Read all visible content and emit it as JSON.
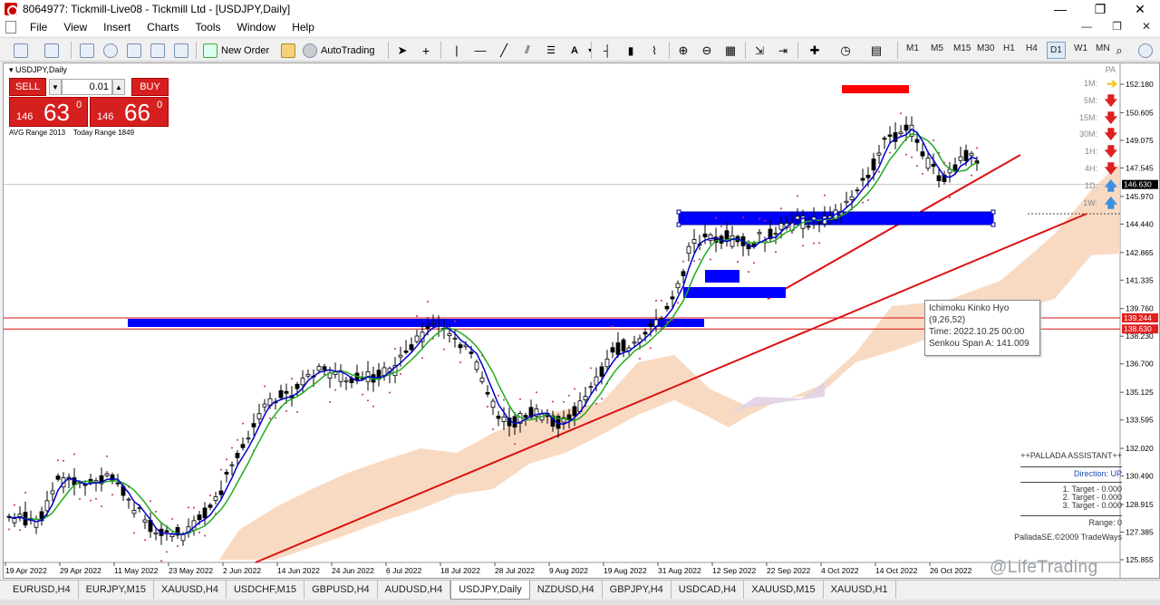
{
  "window": {
    "title": "8064977: Tickmill-Live08 - Tickmill Ltd - [USDJPY,Daily]",
    "minimize": "—",
    "maximize": "❐",
    "close": "✕"
  },
  "menu": {
    "items": [
      "File",
      "View",
      "Insert",
      "Charts",
      "Tools",
      "Window",
      "Help"
    ],
    "right_controls": [
      "—",
      "❐",
      "✕"
    ]
  },
  "toolbar": {
    "new_order_label": "New Order",
    "autotrading_label": "AutoTrading",
    "timeframes": [
      "M1",
      "M5",
      "M15",
      "M30",
      "H1",
      "H4",
      "D1",
      "W1",
      "MN"
    ],
    "active_timeframe": "D1",
    "icons": [
      "new-chart-icon",
      "profiles-icon",
      "market-watch-icon",
      "data-window-icon",
      "navigator-icon",
      "terminal-icon",
      "tester-icon",
      "new-order-icon",
      "autotrading-icon",
      "cursor-icon",
      "crosshair-icon",
      "vertical-line-icon",
      "horizontal-line-icon",
      "trendline-icon",
      "channel-icon",
      "fibonacci-icon",
      "text-icon",
      "arrows-icon",
      "bar-chart-icon",
      "candles-icon",
      "line-chart-icon",
      "zoom-in-icon",
      "zoom-out-icon",
      "tile-icon",
      "autoscroll-icon",
      "chart-shift-icon",
      "indicators-icon",
      "periods-icon",
      "templates-icon",
      "search-icon"
    ]
  },
  "chart": {
    "symbol_label": "USDJPY,Daily",
    "pa_label": "PA",
    "current_price_label": "146.630",
    "level_labels": [
      "139.244",
      "138.630"
    ],
    "y_ticks": [
      "152.180",
      "150.605",
      "149.075",
      "147.545",
      "145.970",
      "144.440",
      "142.865",
      "141.335",
      "139.760",
      "138.230",
      "136.700",
      "135.125",
      "133.595",
      "132.020",
      "130.490",
      "128.915",
      "127.385",
      "125.855"
    ],
    "x_ticks": [
      "19 Apr 2022",
      "29 Apr 2022",
      "11 May 2022",
      "23 May 2022",
      "2 Jun 2022",
      "14 Jun 2022",
      "24 Jun 2022",
      "6 Jul 2022",
      "18 Jul 2022",
      "28 Jul 2022",
      "9 Aug 2022",
      "19 Aug 2022",
      "31 Aug 2022",
      "12 Sep 2022",
      "22 Sep 2022",
      "4 Oct 2022",
      "14 Oct 2022",
      "26 Oct 2022"
    ],
    "colors": {
      "bull": "#000000",
      "ma_fast": "#0000cc",
      "ma_slow": "#22aa22",
      "cloud": "#f7d4b8",
      "zone": "#0000ff",
      "trend": "#dd1111",
      "psar": "#c03060"
    }
  },
  "trade_panel": {
    "sell_label": "SELL",
    "buy_label": "BUY",
    "lot_value": "0.01",
    "sell_price_big": "146",
    "sell_price_main": "63",
    "sell_price_sup": "0",
    "buy_price_big": "146",
    "buy_price_main": "66",
    "buy_price_sup": "0",
    "range_info": "AVG Range 2013    Today Range 1849"
  },
  "signals": [
    {
      "tf": "1M:",
      "arrow": "➔",
      "color": "#f5c518"
    },
    {
      "tf": "5M:",
      "arrow": "🡇",
      "color": "#e02020"
    },
    {
      "tf": "15M:",
      "arrow": "🡇",
      "color": "#e02020"
    },
    {
      "tf": "30M:",
      "arrow": "🡇",
      "color": "#e02020"
    },
    {
      "tf": "1H:",
      "arrow": "🡇",
      "color": "#e02020"
    },
    {
      "tf": "4H:",
      "arrow": "🡇",
      "color": "#e02020"
    },
    {
      "tf": "1D:",
      "arrow": "🡅",
      "color": "#3d8fe0"
    },
    {
      "tf": "1W:",
      "arrow": "🡅",
      "color": "#3d8fe0"
    }
  ],
  "tooltip": {
    "line1": "Ichimoku Kinko Hyo",
    "line2": "(9,26,52)",
    "line3": "Time: 2022.10.25 00:00",
    "line4": "Senkou Span A: 141.009"
  },
  "pallada": {
    "title": "++PALLADA ASSISTANT++",
    "direction": "Direction: UP",
    "target1": "1. Target - 0.000",
    "target2": "2. Target - 0.000",
    "target3": "3. Target - 0.000",
    "range": "Range: 0",
    "copyright": "PalladaSE.©2009 TradeWays"
  },
  "watermark": "@LifeTrading",
  "tabs": [
    "EURUSD,H4",
    "EURJPY,M15",
    "XAUUSD,H4",
    "USDCHF,M15",
    "GBPUSD,H4",
    "AUDUSD,H4",
    "USDJPY,Daily",
    "NZDUSD,H4",
    "GBPJPY,H4",
    "USDCAD,H4",
    "XAUUSD,M15",
    "XAUUSD,H1"
  ],
  "active_tab": "USDJPY,Daily"
}
